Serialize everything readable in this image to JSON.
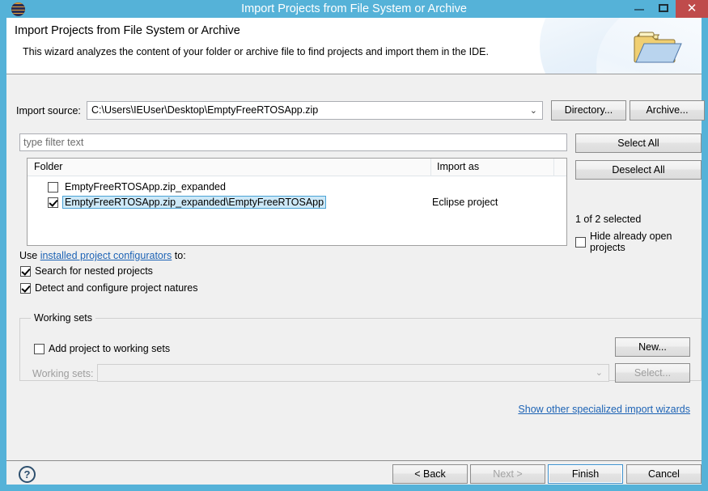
{
  "window": {
    "title": "Import Projects from File System or Archive",
    "icon": "eclipse-icon",
    "minimize_label": "─",
    "maximize_label": "□",
    "close_label": "✕"
  },
  "banner": {
    "title": "Import Projects from File System or Archive",
    "subtitle": "This wizard analyzes the content of your folder or archive file to find projects and import them in the IDE.",
    "icon": "open-folder-icon"
  },
  "import_source": {
    "label": "Import source:",
    "value": "C:\\Users\\IEUser\\Desktop\\EmptyFreeRTOSApp.zip",
    "dropdown_arrow": "⌄",
    "directory_button": "Directory...",
    "archive_button": "Archive..."
  },
  "filter": {
    "value": "",
    "placeholder": "type filter text"
  },
  "selection_buttons": {
    "select_all": "Select All",
    "deselect_all": "Deselect All"
  },
  "tree": {
    "columns": [
      "Folder",
      "Import as"
    ],
    "rows": [
      {
        "checked": false,
        "selected": false,
        "folder": "EmptyFreeRTOSApp.zip_expanded",
        "import_as": ""
      },
      {
        "checked": true,
        "selected": true,
        "folder": "EmptyFreeRTOSApp.zip_expanded\\EmptyFreeRTOSApp",
        "import_as": "Eclipse project"
      }
    ]
  },
  "status": {
    "selected_count": "1 of 2 selected",
    "hide_open_projects": {
      "label": "Hide already open projects",
      "checked": false
    }
  },
  "configurators": {
    "prefix": "Use ",
    "link": "installed project configurators",
    "suffix": " to:",
    "options": [
      {
        "label": "Search for nested projects",
        "checked": true
      },
      {
        "label": "Detect and configure project natures",
        "checked": true
      }
    ]
  },
  "working_sets": {
    "group_title": "Working sets",
    "add_checkbox": {
      "label": "Add project to working sets",
      "checked": false
    },
    "sets_label": "Working sets:",
    "sets_value": "",
    "sets_arrow": "⌄",
    "new_button": "New...",
    "select_button": "Select..."
  },
  "specialized_link": "Show other specialized import wizards",
  "footer": {
    "help": "?",
    "back": "< Back",
    "next": "Next >",
    "finish": "Finish",
    "cancel": "Cancel"
  },
  "colors": {
    "window_chrome": "#55b2d8",
    "close_button": "#bf4b4b",
    "dialog_bg": "#f0f0f0",
    "link": "#1d63b5",
    "selection": "#cde8f7",
    "selection_border": "#4aa3d6",
    "focus_border": "#3c90ce"
  }
}
